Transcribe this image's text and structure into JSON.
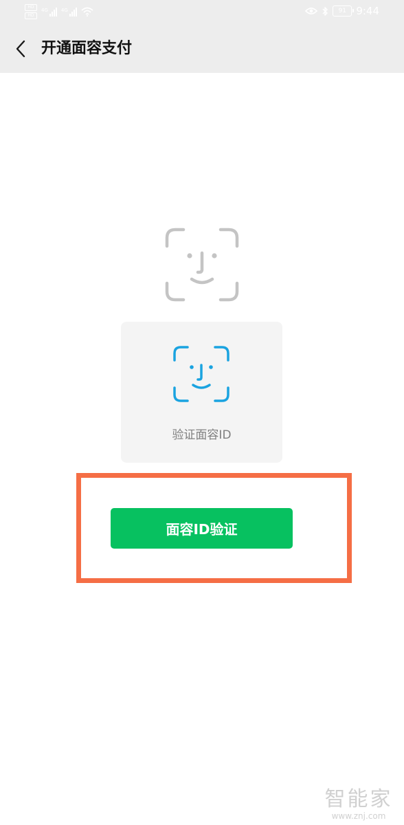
{
  "status_bar": {
    "hd_labels": [
      "HD",
      "HD"
    ],
    "signal_tags": [
      "4G",
      "4G"
    ],
    "icons": [
      "eye-icon",
      "bluetooth-icon",
      "wifi-icon"
    ],
    "battery_level": "91",
    "time": "9:44"
  },
  "header": {
    "back_icon": "chevron-left-icon",
    "title": "开通面容支付"
  },
  "main": {
    "face_card": {
      "icon": "face-id-icon",
      "label": "验证面容ID"
    },
    "verify_button_label": "面容ID验证"
  },
  "watermark": {
    "logo_text": "智能家",
    "url": "www.znj.com"
  },
  "colors": {
    "nav_background": "#ededed",
    "face_icon_gray": "#c4c4c4",
    "face_icon_blue": "#1aa3e0",
    "button_green": "#07c160",
    "highlight_orange": "#f56e45"
  }
}
